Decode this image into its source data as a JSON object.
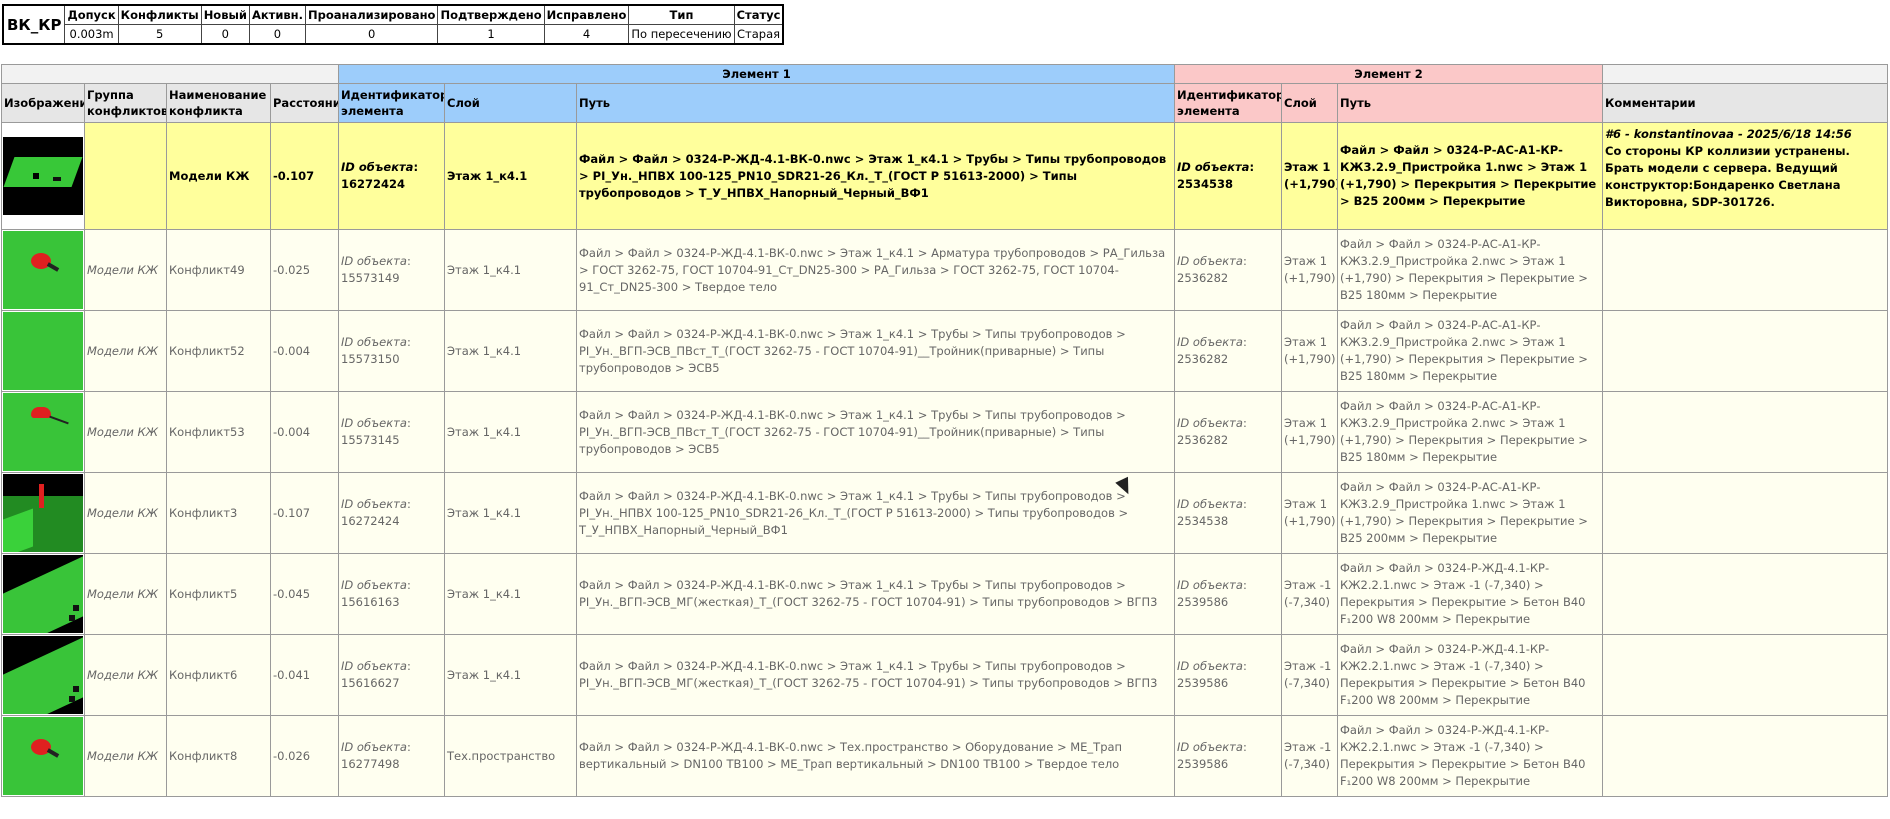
{
  "summary": {
    "name": "ВК_КР",
    "headers": [
      "Допуск",
      "Конфликты",
      "Новый",
      "Активн.",
      "Проанализировано",
      "Подтверждено",
      "Исправлено",
      "Тип",
      "Статус"
    ],
    "values": [
      "0.003m",
      "5",
      "0",
      "0",
      "0",
      "1",
      "4",
      "По пересечению",
      "Старая"
    ]
  },
  "groups": {
    "element1": "Элемент 1",
    "element2": "Элемент 2"
  },
  "columns": {
    "image": "Изображение",
    "group": "Группа конфликтов",
    "name": "Наименование конфликта",
    "distance": "Расстояние",
    "id1": "Идентификатор элемента",
    "layer1": "Слой",
    "path1": "Путь",
    "id2": "Идентификатор элемента",
    "layer2": "Слой",
    "path2": "Путь",
    "comments": "Комментарии"
  },
  "id_prefix": "ID объекта",
  "rows": [
    {
      "active": true,
      "thumb": "flat-dark",
      "group": "",
      "name": "Модели КЖ",
      "distance": "-0.107",
      "id1": "16272424",
      "layer1": "Этаж 1_к4.1",
      "path1": "Файл > Файл > 0324-Р-ЖД-4.1-ВК-0.nwc > Этаж 1_к4.1 > Трубы > Типы трубопроводов > PI_Ун._НПВХ 100-125_PN10_SDR21-26_Кл._Т_(ГОСТ Р 51613-2000) > Типы трубопроводов > Т_У_НПВХ_Напорный_Черный_ВФ1",
      "id2": "2534538",
      "layer2": "Этаж 1 (+1,790)",
      "path2": "Файл > Файл > 0324-Р-АС-А1-КР-КЖ3.2.9_Пристройка 1.nwc > Этаж 1 (+1,790) > Перекрытия > Перекрытие > В25 200мм > Перекрытие",
      "comment_head": "#6 - konstantinovaa - 2025/6/18  14:56",
      "comment": "Со стороны КР коллизии устранены. Брать модели с сервера. Ведущий конструктор:Бондаренко Светлана Викторовна, SDP-301726."
    },
    {
      "active": false,
      "thumb": "red-disc",
      "group": "Модели КЖ",
      "name": "Конфликт49",
      "distance": "-0.025",
      "id1": "15573149",
      "layer1": "Этаж 1_к4.1",
      "path1": "Файл > Файл > 0324-Р-ЖД-4.1-ВК-0.nwc > Этаж 1_к4.1 > Арматура трубопроводов > РА_Гильза > ГОСТ 3262-75, ГОСТ 10704-91_Ст_DN25-300 > РА_Гильза > ГОСТ 3262-75, ГОСТ 10704-91_Ст_DN25-300 > Твердое тело",
      "id2": "2536282",
      "layer2": "Этаж 1 (+1,790)",
      "path2": "Файл > Файл > 0324-Р-АС-А1-КР-КЖ3.2.9_Пристройка 2.nwc > Этаж 1 (+1,790) > Перекрытия > Перекрытие > В25 180мм > Перекрытие",
      "comment_head": "",
      "comment": ""
    },
    {
      "active": false,
      "thumb": "green",
      "group": "Модели КЖ",
      "name": "Конфликт52",
      "distance": "-0.004",
      "id1": "15573150",
      "layer1": "Этаж 1_к4.1",
      "path1": "Файл > Файл > 0324-Р-ЖД-4.1-ВК-0.nwc > Этаж 1_к4.1 > Трубы > Типы трубопроводов > PI_Ун._ВГП-ЭСВ_ПВст_Т_(ГОСТ 3262-75 - ГОСТ 10704-91)__Тройник(приварные) > Типы трубопроводов > ЭСВ5",
      "id2": "2536282",
      "layer2": "Этаж 1 (+1,790)",
      "path2": "Файл > Файл > 0324-Р-АС-А1-КР-КЖ3.2.9_Пристройка 2.nwc > Этаж 1 (+1,790) > Перекрытия > Перекрытие > В25 180мм > Перекрытие",
      "comment_head": "",
      "comment": ""
    },
    {
      "active": false,
      "thumb": "red-half",
      "group": "Модели КЖ",
      "name": "Конфликт53",
      "distance": "-0.004",
      "id1": "15573145",
      "layer1": "Этаж 1_к4.1",
      "path1": "Файл > Файл > 0324-Р-ЖД-4.1-ВК-0.nwc > Этаж 1_к4.1 > Трубы > Типы трубопроводов > PI_Ун._ВГП-ЭСВ_ПВст_Т_(ГОСТ 3262-75 - ГОСТ 10704-91)__Тройник(приварные) > Типы трубопроводов > ЭСВ5",
      "id2": "2536282",
      "layer2": "Этаж 1 (+1,790)",
      "path2": "Файл > Файл > 0324-Р-АС-А1-КР-КЖ3.2.9_Пристройка 2.nwc > Этаж 1 (+1,790) > Перекрытия > Перекрытие > В25 180мм > Перекрытие",
      "comment_head": "",
      "comment": ""
    },
    {
      "active": false,
      "thumb": "pipe",
      "group": "Модели КЖ",
      "name": "Конфликт3",
      "distance": "-0.107",
      "id1": "16272424",
      "layer1": "Этаж 1_к4.1",
      "path1": "Файл > Файл > 0324-Р-ЖД-4.1-ВК-0.nwc > Этаж 1_к4.1 > Трубы > Типы трубопроводов > PI_Ун._НПВХ 100-125_PN10_SDR21-26_Кл._Т_(ГОСТ Р 51613-2000) > Типы трубопроводов > Т_У_НПВХ_Напорный_Черный_ВФ1",
      "id2": "2534538",
      "layer2": "Этаж 1 (+1,790)",
      "path2": "Файл > Файл > 0324-Р-АС-А1-КР-КЖ3.2.9_Пристройка 1.nwc > Этаж 1 (+1,790) > Перекрытия > Перекрытие > В25 200мм > Перекрытие",
      "comment_head": "",
      "comment": ""
    },
    {
      "active": false,
      "thumb": "slab",
      "group": "Модели КЖ",
      "name": "Конфликт5",
      "distance": "-0.045",
      "id1": "15616163",
      "layer1": "Этаж 1_к4.1",
      "path1": "Файл > Файл > 0324-Р-ЖД-4.1-ВК-0.nwc > Этаж 1_к4.1 > Трубы > Типы трубопроводов > PI_Ун._ВГП-ЭСВ_МГ(жесткая)_Т_(ГОСТ 3262-75 - ГОСТ 10704-91) > Типы трубопроводов > ВГП3",
      "id2": "2539586",
      "layer2": "Этаж -1 (-7,340)",
      "path2": "Файл > Файл > 0324-Р-ЖД-4.1-КР-КЖ2.2.1.nwc > Этаж -1 (-7,340) > Перекрытия > Перекрытие > Бетон В40 F₁200 W8 200мм > Перекрытие",
      "comment_head": "",
      "comment": ""
    },
    {
      "active": false,
      "thumb": "slab",
      "group": "Модели КЖ",
      "name": "Конфликт6",
      "distance": "-0.041",
      "id1": "15616627",
      "layer1": "Этаж 1_к4.1",
      "path1": "Файл > Файл > 0324-Р-ЖД-4.1-ВК-0.nwc > Этаж 1_к4.1 > Трубы > Типы трубопроводов > PI_Ун._ВГП-ЭСВ_МГ(жесткая)_Т_(ГОСТ 3262-75 - ГОСТ 10704-91) > Типы трубопроводов > ВГП3",
      "id2": "2539586",
      "layer2": "Этаж -1 (-7,340)",
      "path2": "Файл > Файл > 0324-Р-ЖД-4.1-КР-КЖ2.2.1.nwc > Этаж -1 (-7,340) > Перекрытия > Перекрытие > Бетон В40 F₁200 W8 200мм > Перекрытие",
      "comment_head": "",
      "comment": ""
    },
    {
      "active": false,
      "thumb": "red-disc",
      "group": "Модели КЖ",
      "name": "Конфликт8",
      "distance": "-0.026",
      "id1": "16277498",
      "layer1": "Тех.пространство",
      "path1": "Файл > Файл > 0324-Р-ЖД-4.1-ВК-0.nwc > Тех.пространство > Оборудование > МЕ_Трап вертикальный > DN100 ТВ100 > МЕ_Трап вертикальный > DN100 ТВ100 > Твердое тело",
      "id2": "2539586",
      "layer2": "Этаж -1 (-7,340)",
      "path2": "Файл > Файл > 0324-Р-ЖД-4.1-КР-КЖ2.2.1.nwc > Этаж -1 (-7,340) > Перекрытия > Перекрытие > Бетон В40 F₁200 W8 200мм > Перекрытие",
      "comment_head": "",
      "comment": ""
    }
  ]
}
